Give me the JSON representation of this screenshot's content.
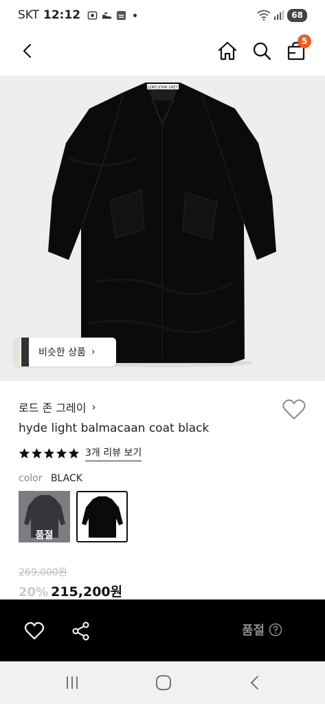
{
  "status_bar": {
    "carrier": "SKT",
    "time": "12:12",
    "battery": "68",
    "icons": [
      "screen-record-icon",
      "shoe-icon",
      "app-notification-icon",
      "dot-icon",
      "wifi-icon",
      "signal-icon",
      "battery-icon"
    ]
  },
  "top_nav": {
    "icons": [
      "back-icon",
      "home-icon",
      "search-icon",
      "shopping-bag-icon"
    ],
    "cart_count": "5",
    "badge_color": "#f25a1e"
  },
  "product_image": {
    "similar_button_label": "비슷한 상품",
    "coat_tag_text": "LORD JOHN GREY",
    "background_color": "#efeded"
  },
  "product": {
    "brand": "로드 존 그레이",
    "name": "hyde light balmacaan coat black",
    "rating_stars": 5,
    "review_link": "3개 리뷰 보기",
    "color_label": "color",
    "color_value": "BLACK",
    "swatches": [
      {
        "name": "gray",
        "status": "품절"
      },
      {
        "name": "black",
        "selected": true
      }
    ],
    "original_price": "269,000원",
    "discount": "20%",
    "sale_price": "215,200원"
  },
  "bottom_bar": {
    "icons": [
      "heart-icon",
      "share-icon",
      "help-icon"
    ],
    "cta_label": "품절",
    "cta_color": "#8d8d8d"
  },
  "system_nav": {
    "icons": [
      "recent-apps-icon",
      "home-circle-icon",
      "back-chevron-icon"
    ]
  }
}
